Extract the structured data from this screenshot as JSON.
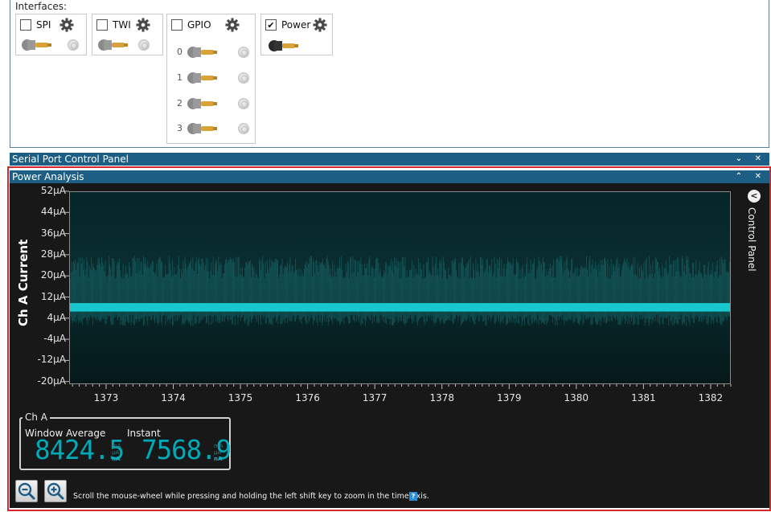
{
  "interfaces": {
    "label": "Interfaces:",
    "spi": {
      "name": "SPI",
      "checked": false
    },
    "twi": {
      "name": "TWI",
      "checked": false
    },
    "gpio": {
      "name": "GPIO",
      "checked": false,
      "pins": [
        "0",
        "1",
        "2",
        "3"
      ]
    },
    "power": {
      "name": "Power",
      "checked": true
    }
  },
  "serial_panel": {
    "title": "Serial Port Control Panel",
    "controls": "⌄ ✕"
  },
  "power_analysis": {
    "title": "Power Analysis",
    "controls": "⌃ ✕",
    "side_panel": {
      "label": "Control Panel",
      "button": "<"
    },
    "cha": {
      "title": "Ch A",
      "window_average_label": "Window Average",
      "instant_label": "Instant",
      "window_average_value": "8424.5",
      "instant_value": "7568.9",
      "units": [
        "mA",
        "µA",
        "nA"
      ],
      "active_unit": "nA"
    },
    "hint": "Scroll the mouse-wheel while pressing and holding the left shift key to zoom in the time axis.",
    "help_icon": "?"
  },
  "colors": {
    "accent_bar": "#1d5e84",
    "signal": "#19c8cf",
    "highlight_border": "#d6262e"
  },
  "chart_data": {
    "type": "line",
    "ylabel": "Ch A Current",
    "xlabel": "",
    "title": "",
    "y_ticks": [
      "52µA",
      "44µA",
      "36µA",
      "28µA",
      "20µA",
      "12µA",
      "4µA",
      "-4µA",
      "-12µA",
      "-20µA"
    ],
    "x_ticks": [
      "1373",
      "1374",
      "1375",
      "1376",
      "1377",
      "1378",
      "1379",
      "1380",
      "1381",
      "1382"
    ],
    "ylim": [
      -21,
      52
    ],
    "xlim": [
      1372.45,
      1382.3
    ],
    "series": [
      {
        "baseline": 8.4,
        "band_low": 5.8,
        "band_high": 28,
        "noise_floor": 3
      }
    ],
    "grid": false
  }
}
